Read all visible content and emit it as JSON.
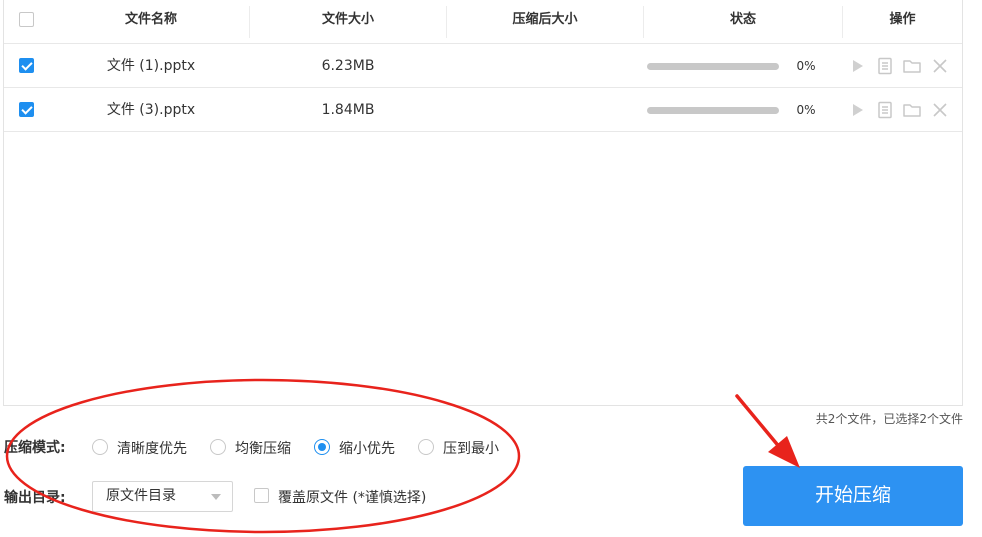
{
  "table": {
    "columns": {
      "name": "文件名称",
      "size": "文件大小",
      "compressed_size": "压缩后大小",
      "status": "状态",
      "actions": "操作"
    },
    "header_checked": false,
    "rows": [
      {
        "checked": true,
        "name": "文件 (1).pptx",
        "size": "6.23MB",
        "compressed_size": "",
        "progress": 0,
        "percent": "0%"
      },
      {
        "checked": true,
        "name": "文件 (3).pptx",
        "size": "1.84MB",
        "compressed_size": "",
        "progress": 0,
        "percent": "0%"
      }
    ],
    "action_icons": [
      "play-icon",
      "document-icon",
      "folder-icon",
      "close-icon"
    ]
  },
  "summary": "共2个文件，已选择2个文件",
  "mode": {
    "label": "压缩模式:",
    "options": [
      "清晰度优先",
      "均衡压缩",
      "缩小优先",
      "压到最小"
    ],
    "selected": "缩小优先"
  },
  "output": {
    "label": "输出目录:",
    "selected": "原文件目录",
    "overwrite_label": "覆盖原文件 (*谨慎选择)",
    "overwrite_checked": false
  },
  "start_button": "开始压缩",
  "colors": {
    "accent": "#2d92f2",
    "annotation": "#e8231c",
    "progress_track": "#c8c8c8"
  }
}
